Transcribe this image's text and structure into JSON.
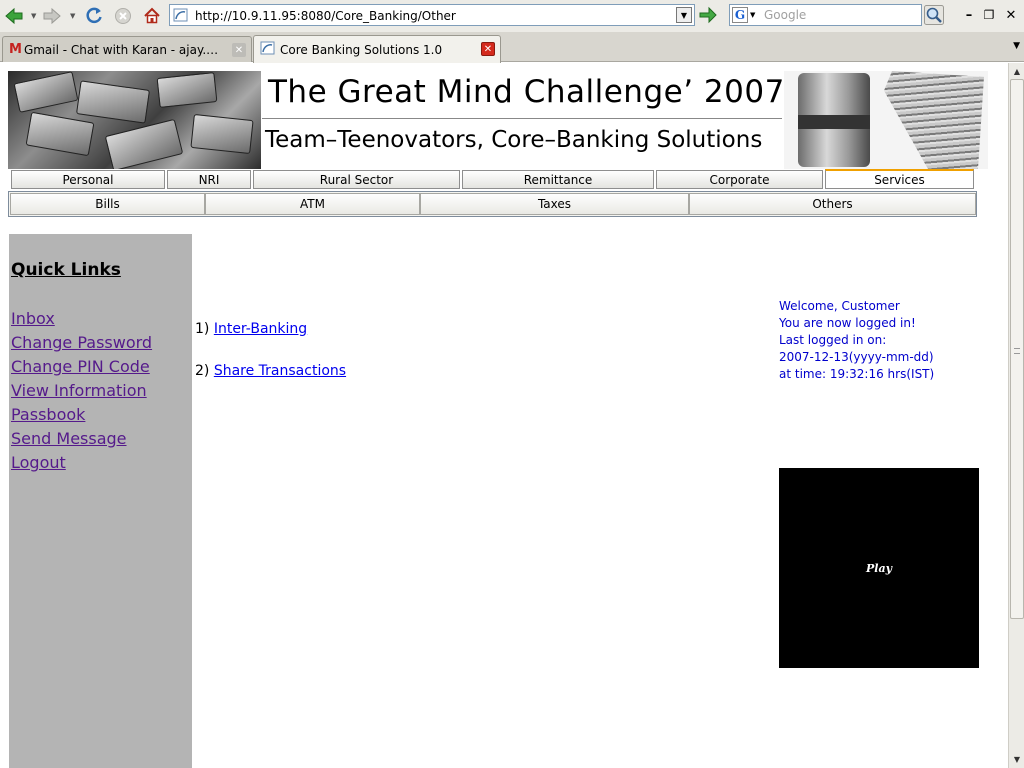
{
  "browser": {
    "url": "http://10.9.11.95:8080/Core_Banking/Other",
    "search_placeholder": "Google",
    "search_engine_letter": "G",
    "tabs": [
      {
        "label": "Gmail - Chat with Karan - ajay.kr…",
        "favicon_letter": "M"
      },
      {
        "label": "Core Banking Solutions 1.0"
      }
    ],
    "window_controls": {
      "minimize": "–",
      "restore": "❐",
      "close": "✕"
    }
  },
  "banner": {
    "title": "The Great Mind Challenge’ 2007",
    "subtitle": "Team–Teenovators, Core–Banking Solutions"
  },
  "menu": {
    "items": [
      "Personal",
      "NRI",
      "Rural Sector",
      "Remittance",
      "Corporate",
      "Services"
    ],
    "active": "Services"
  },
  "submenu": {
    "items": [
      "Bills",
      "ATM",
      "Taxes",
      "Others"
    ]
  },
  "quick_links": {
    "title": "Quick Links",
    "items": [
      "Inbox",
      "Change Password",
      "Change PIN Code",
      "View Information",
      "Passbook",
      "Send Message",
      "Logout"
    ]
  },
  "main": {
    "items": [
      {
        "number": "1)",
        "label": "Inter-Banking"
      },
      {
        "number": "2)",
        "label": "Share Transactions"
      }
    ]
  },
  "welcome": {
    "lines": [
      "Welcome, Customer",
      "You are now logged in!",
      "Last logged in on:",
      "2007-12-13(yyyy-mm-dd)",
      "at time: 19:32:16 hrs(IST)"
    ]
  },
  "video": {
    "play_label": "Play"
  },
  "colors": {
    "link_visited": "#551a8b",
    "link": "#0000ee",
    "welcome_text": "#0000cc",
    "sidebar_bg": "#b4b4b4",
    "active_tab_accent": "#f0a000"
  }
}
